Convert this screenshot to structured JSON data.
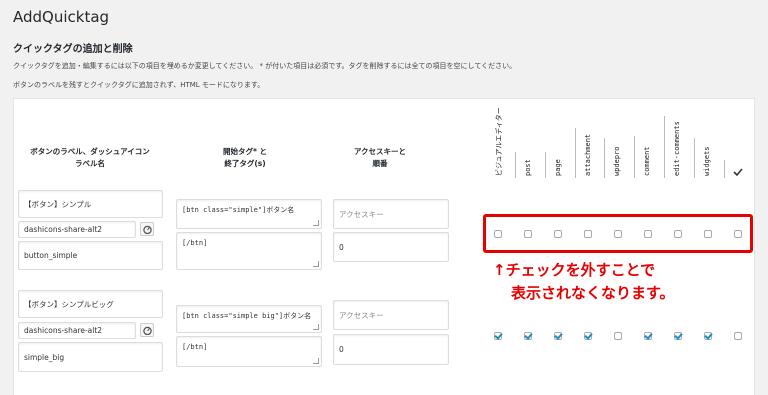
{
  "header": {
    "title": "AddQuicktag",
    "section_title": "クイックタグの追加と削除",
    "desc1": "クイックタグを追加・編集するには以下の項目を埋めるか変更してください。 * が付いた項目は必須です。タグを削除するには全ての項目を空にしてください。",
    "desc2": "ボタンのラベルを残すとクイックタグに追加されず、HTML モードになります。"
  },
  "columns": {
    "label_col": [
      "ボタンのラベル、ダッシュアイコン",
      "ラベル名"
    ],
    "tag_col": [
      "開始タグ* と",
      "終了タグ(s)"
    ],
    "key_col": [
      "アクセスキーと",
      "順番"
    ],
    "checkbox_cols": [
      "ビジュアルエディター",
      "post",
      "page",
      "attachment",
      "wpdepro",
      "comment",
      "edit-comments",
      "widgets"
    ],
    "checkall_icon": "checkmark-icon"
  },
  "rows": [
    {
      "button_label": "【ボタン】シンプル",
      "dashicon": "dashicons-share-alt2",
      "title": "button_simple",
      "start_tag": "[btn class=\"simple\"]ボタン名",
      "end_tag": "[/btn]",
      "access_key_placeholder": "アクセスキー",
      "order": "0",
      "checks": [
        false,
        false,
        false,
        false,
        false,
        false,
        false,
        false,
        false
      ]
    },
    {
      "button_label": "【ボタン】シンプルビッグ",
      "dashicon": "dashicons-share-alt2",
      "title": "simple_big",
      "start_tag": "[btn class=\"simple big\"]ボタン名",
      "end_tag": "[/btn]",
      "access_key_placeholder": "アクセスキー",
      "order": "0",
      "checks": [
        true,
        true,
        true,
        true,
        false,
        true,
        true,
        true,
        false
      ]
    }
  ],
  "annotation": {
    "line1": "↑チェックを外すことで",
    "line2": "表示されなくなります。",
    "color": "#e60000"
  },
  "accent_color": "#1e8cbe"
}
